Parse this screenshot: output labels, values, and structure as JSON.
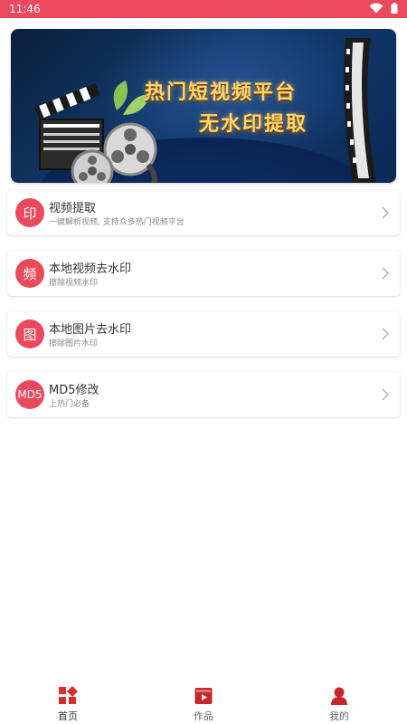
{
  "status": {
    "time": "11:46",
    "bar_color": "#e94a5e"
  },
  "banner": {
    "headline": "热门短视频平台",
    "subheadline": "无水印提取"
  },
  "items": [
    {
      "avatar": "印",
      "title": "视频提取",
      "subtitle": "一键解析视频, 支持众多热门视频平台"
    },
    {
      "avatar": "频",
      "title": "本地视频去水印",
      "subtitle": "擦除视频水印"
    },
    {
      "avatar": "图",
      "title": "本地图片去水印",
      "subtitle": "擦除图片水印"
    },
    {
      "avatar": "MD5",
      "title": "MD5修改",
      "subtitle": "上热门必备"
    }
  ],
  "tabs": [
    {
      "label": "首页",
      "icon": "home-grid-icon",
      "active": true
    },
    {
      "label": "作品",
      "icon": "video-play-icon",
      "active": false
    },
    {
      "label": "我的",
      "icon": "user-icon",
      "active": false
    }
  ],
  "colors": {
    "accent": "#e94a5e",
    "tab_icon": "#d32f2f"
  }
}
